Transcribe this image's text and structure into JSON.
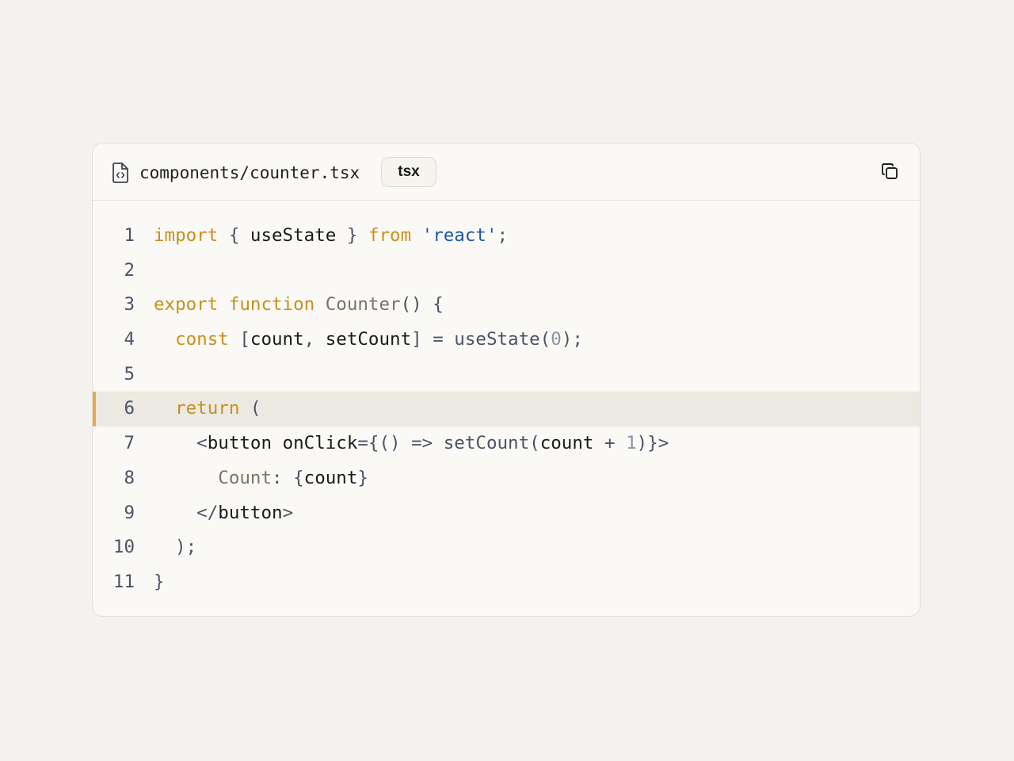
{
  "file": {
    "name": "components/counter.tsx",
    "language": "tsx"
  },
  "icons": {
    "file": "file-code-icon",
    "copy": "copy-icon"
  },
  "colors": {
    "keyword": "#c98f1e",
    "string": "#1f57a8",
    "highlight_bar": "#e2ad4f",
    "highlight_bg": "#ece9e2"
  },
  "code": {
    "highlighted_line": 6,
    "lines": [
      {
        "n": "1",
        "t": [
          [
            "kw",
            "import"
          ],
          [
            "pn",
            " { "
          ],
          [
            "id",
            "useState"
          ],
          [
            "pn",
            " } "
          ],
          [
            "kw",
            "from"
          ],
          [
            "pn",
            " "
          ],
          [
            "str",
            "'react'"
          ],
          [
            "pn",
            ";"
          ]
        ]
      },
      {
        "n": "2",
        "t": []
      },
      {
        "n": "3",
        "t": [
          [
            "kw",
            "export"
          ],
          [
            "pn",
            " "
          ],
          [
            "kw",
            "function"
          ],
          [
            "pn",
            " "
          ],
          [
            "fn",
            "Counter"
          ],
          [
            "pn",
            "() {"
          ]
        ]
      },
      {
        "n": "4",
        "t": [
          [
            "pn",
            "  "
          ],
          [
            "kw",
            "const"
          ],
          [
            "pn",
            " ["
          ],
          [
            "id",
            "count"
          ],
          [
            "pn",
            ", "
          ],
          [
            "id",
            "setCount"
          ],
          [
            "pn",
            "] = useState("
          ],
          [
            "num",
            "0"
          ],
          [
            "pn",
            ");"
          ]
        ]
      },
      {
        "n": "5",
        "t": []
      },
      {
        "n": "6",
        "t": [
          [
            "pn",
            "  "
          ],
          [
            "kw",
            "return"
          ],
          [
            "pn",
            " ("
          ]
        ]
      },
      {
        "n": "7",
        "t": [
          [
            "pn",
            "    <"
          ],
          [
            "id",
            "button"
          ],
          [
            "pn",
            " "
          ],
          [
            "id",
            "onClick"
          ],
          [
            "pn",
            "={() => setCount("
          ],
          [
            "id",
            "count"
          ],
          [
            "pn",
            " + "
          ],
          [
            "num",
            "1"
          ],
          [
            "pn",
            ")}>"
          ]
        ]
      },
      {
        "n": "8",
        "t": [
          [
            "pn",
            "      "
          ],
          [
            "fn",
            "Count"
          ],
          [
            "pn",
            ": {"
          ],
          [
            "id",
            "count"
          ],
          [
            "pn",
            "}"
          ]
        ]
      },
      {
        "n": "9",
        "t": [
          [
            "pn",
            "    </"
          ],
          [
            "id",
            "button"
          ],
          [
            "pn",
            ">"
          ]
        ]
      },
      {
        "n": "10",
        "t": [
          [
            "pn",
            "  );"
          ]
        ]
      },
      {
        "n": "11",
        "t": [
          [
            "pn",
            "}"
          ]
        ]
      }
    ]
  }
}
